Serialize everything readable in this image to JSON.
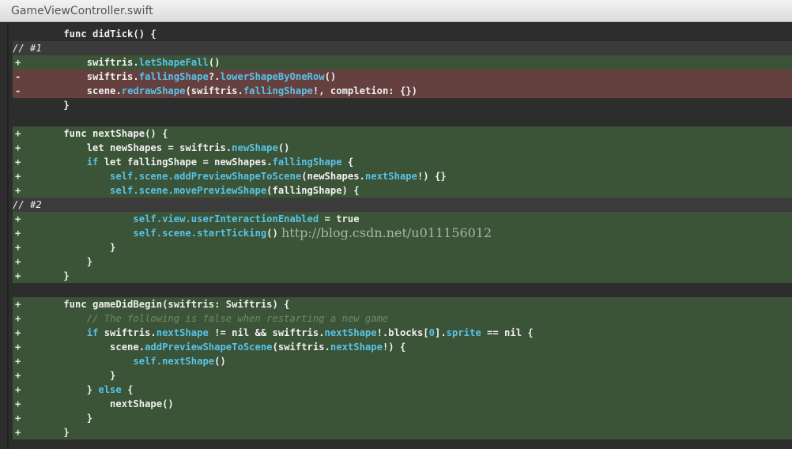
{
  "window": {
    "title": "GameViewController.swift"
  },
  "watermark": "http://blog.csdn.net/u011156012",
  "colors": {
    "added_bg": "#3b5336",
    "removed_bg": "#64403f",
    "member": "#59c3e8",
    "editor_bg": "#2d2d2d"
  },
  "lines": [
    {
      "type": "ctx",
      "marker": "",
      "tokens": [
        [
          "tx",
          "    func didTick() {"
        ]
      ]
    },
    {
      "type": "comment",
      "marker": "",
      "tokens": [
        [
          "tx",
          "// #1"
        ]
      ]
    },
    {
      "type": "add",
      "marker": "+",
      "tokens": [
        [
          "tx",
          "        swiftris."
        ],
        [
          "fn",
          "letShapeFall"
        ],
        [
          "tx",
          "()"
        ]
      ]
    },
    {
      "type": "del",
      "marker": "-",
      "tokens": [
        [
          "tx",
          "        swiftris."
        ],
        [
          "fn",
          "fallingShape"
        ],
        [
          "tx",
          "?."
        ],
        [
          "fn",
          "lowerShapeByOneRow"
        ],
        [
          "tx",
          "()"
        ]
      ]
    },
    {
      "type": "del",
      "marker": "-",
      "tokens": [
        [
          "tx",
          "        scene."
        ],
        [
          "fn",
          "redrawShape"
        ],
        [
          "tx",
          "(swiftris."
        ],
        [
          "fn",
          "fallingShape"
        ],
        [
          "tx",
          "!, completion: {})"
        ]
      ]
    },
    {
      "type": "ctx",
      "marker": "",
      "tokens": [
        [
          "tx",
          "    }"
        ]
      ]
    },
    {
      "type": "blank",
      "marker": "",
      "tokens": []
    },
    {
      "type": "add",
      "marker": "+",
      "tokens": [
        [
          "tx",
          "    func nextShape() {"
        ]
      ]
    },
    {
      "type": "add",
      "marker": "+",
      "tokens": [
        [
          "tx",
          "        let newShapes = swiftris."
        ],
        [
          "fn",
          "newShape"
        ],
        [
          "tx",
          "()"
        ]
      ]
    },
    {
      "type": "add",
      "marker": "+",
      "tokens": [
        [
          "fn",
          "        if"
        ],
        [
          "tx",
          " let fallingShape = newShapes."
        ],
        [
          "fn",
          "fallingShape"
        ],
        [
          "tx",
          " {"
        ]
      ]
    },
    {
      "type": "add",
      "marker": "+",
      "tokens": [
        [
          "fn",
          "            self.scene.addPreviewShapeToScene"
        ],
        [
          "tx",
          "(newShapes."
        ],
        [
          "fn",
          "nextShape"
        ],
        [
          "tx",
          "!) {}"
        ]
      ]
    },
    {
      "type": "add",
      "marker": "+",
      "tokens": [
        [
          "fn",
          "            self.scene.movePreviewShape"
        ],
        [
          "tx",
          "(fallingShape) {"
        ]
      ]
    },
    {
      "type": "comment",
      "marker": "",
      "tokens": [
        [
          "tx",
          "// #2"
        ]
      ]
    },
    {
      "type": "add",
      "marker": "+",
      "tokens": [
        [
          "fn",
          "                self.view.userInteractionEnabled"
        ],
        [
          "tx",
          " = true"
        ]
      ]
    },
    {
      "type": "add",
      "marker": "+",
      "tokens": [
        [
          "fn",
          "                self.scene.startTicking"
        ],
        [
          "tx",
          "()"
        ]
      ]
    },
    {
      "type": "add",
      "marker": "+",
      "tokens": [
        [
          "tx",
          "            }"
        ]
      ]
    },
    {
      "type": "add",
      "marker": "+",
      "tokens": [
        [
          "tx",
          "        }"
        ]
      ]
    },
    {
      "type": "add",
      "marker": "+",
      "tokens": [
        [
          "tx",
          "    }"
        ]
      ]
    },
    {
      "type": "blank",
      "marker": "",
      "tokens": []
    },
    {
      "type": "add",
      "marker": "+",
      "tokens": [
        [
          "tx",
          "    func gameDidBegin(swiftris: Swiftris) {"
        ]
      ]
    },
    {
      "type": "add",
      "marker": "+",
      "tokens": [
        [
          "cmt",
          "        // The following is false when restarting a new game"
        ]
      ]
    },
    {
      "type": "add",
      "marker": "+",
      "tokens": [
        [
          "fn",
          "        if"
        ],
        [
          "tx",
          " swiftris."
        ],
        [
          "fn",
          "nextShape"
        ],
        [
          "tx",
          " != nil && swiftris."
        ],
        [
          "fn",
          "nextShape"
        ],
        [
          "tx",
          "!.blocks["
        ],
        [
          "fn",
          "0"
        ],
        [
          "tx",
          "]."
        ],
        [
          "fn",
          "sprite"
        ],
        [
          "tx",
          " == nil {"
        ]
      ]
    },
    {
      "type": "add",
      "marker": "+",
      "tokens": [
        [
          "tx",
          "            scene."
        ],
        [
          "fn",
          "addPreviewShapeToScene"
        ],
        [
          "tx",
          "(swiftris."
        ],
        [
          "fn",
          "nextShape"
        ],
        [
          "tx",
          "!) {"
        ]
      ]
    },
    {
      "type": "add",
      "marker": "+",
      "tokens": [
        [
          "fn",
          "                self.nextShape"
        ],
        [
          "tx",
          "()"
        ]
      ]
    },
    {
      "type": "add",
      "marker": "+",
      "tokens": [
        [
          "tx",
          "            }"
        ]
      ]
    },
    {
      "type": "add",
      "marker": "+",
      "tokens": [
        [
          "tx",
          "        } "
        ],
        [
          "fn",
          "else"
        ],
        [
          "tx",
          " {"
        ]
      ]
    },
    {
      "type": "add",
      "marker": "+",
      "tokens": [
        [
          "tx",
          "            nextShape()"
        ]
      ]
    },
    {
      "type": "add",
      "marker": "+",
      "tokens": [
        [
          "tx",
          "        }"
        ]
      ]
    },
    {
      "type": "add",
      "marker": "+",
      "tokens": [
        [
          "tx",
          "    }"
        ]
      ]
    }
  ]
}
